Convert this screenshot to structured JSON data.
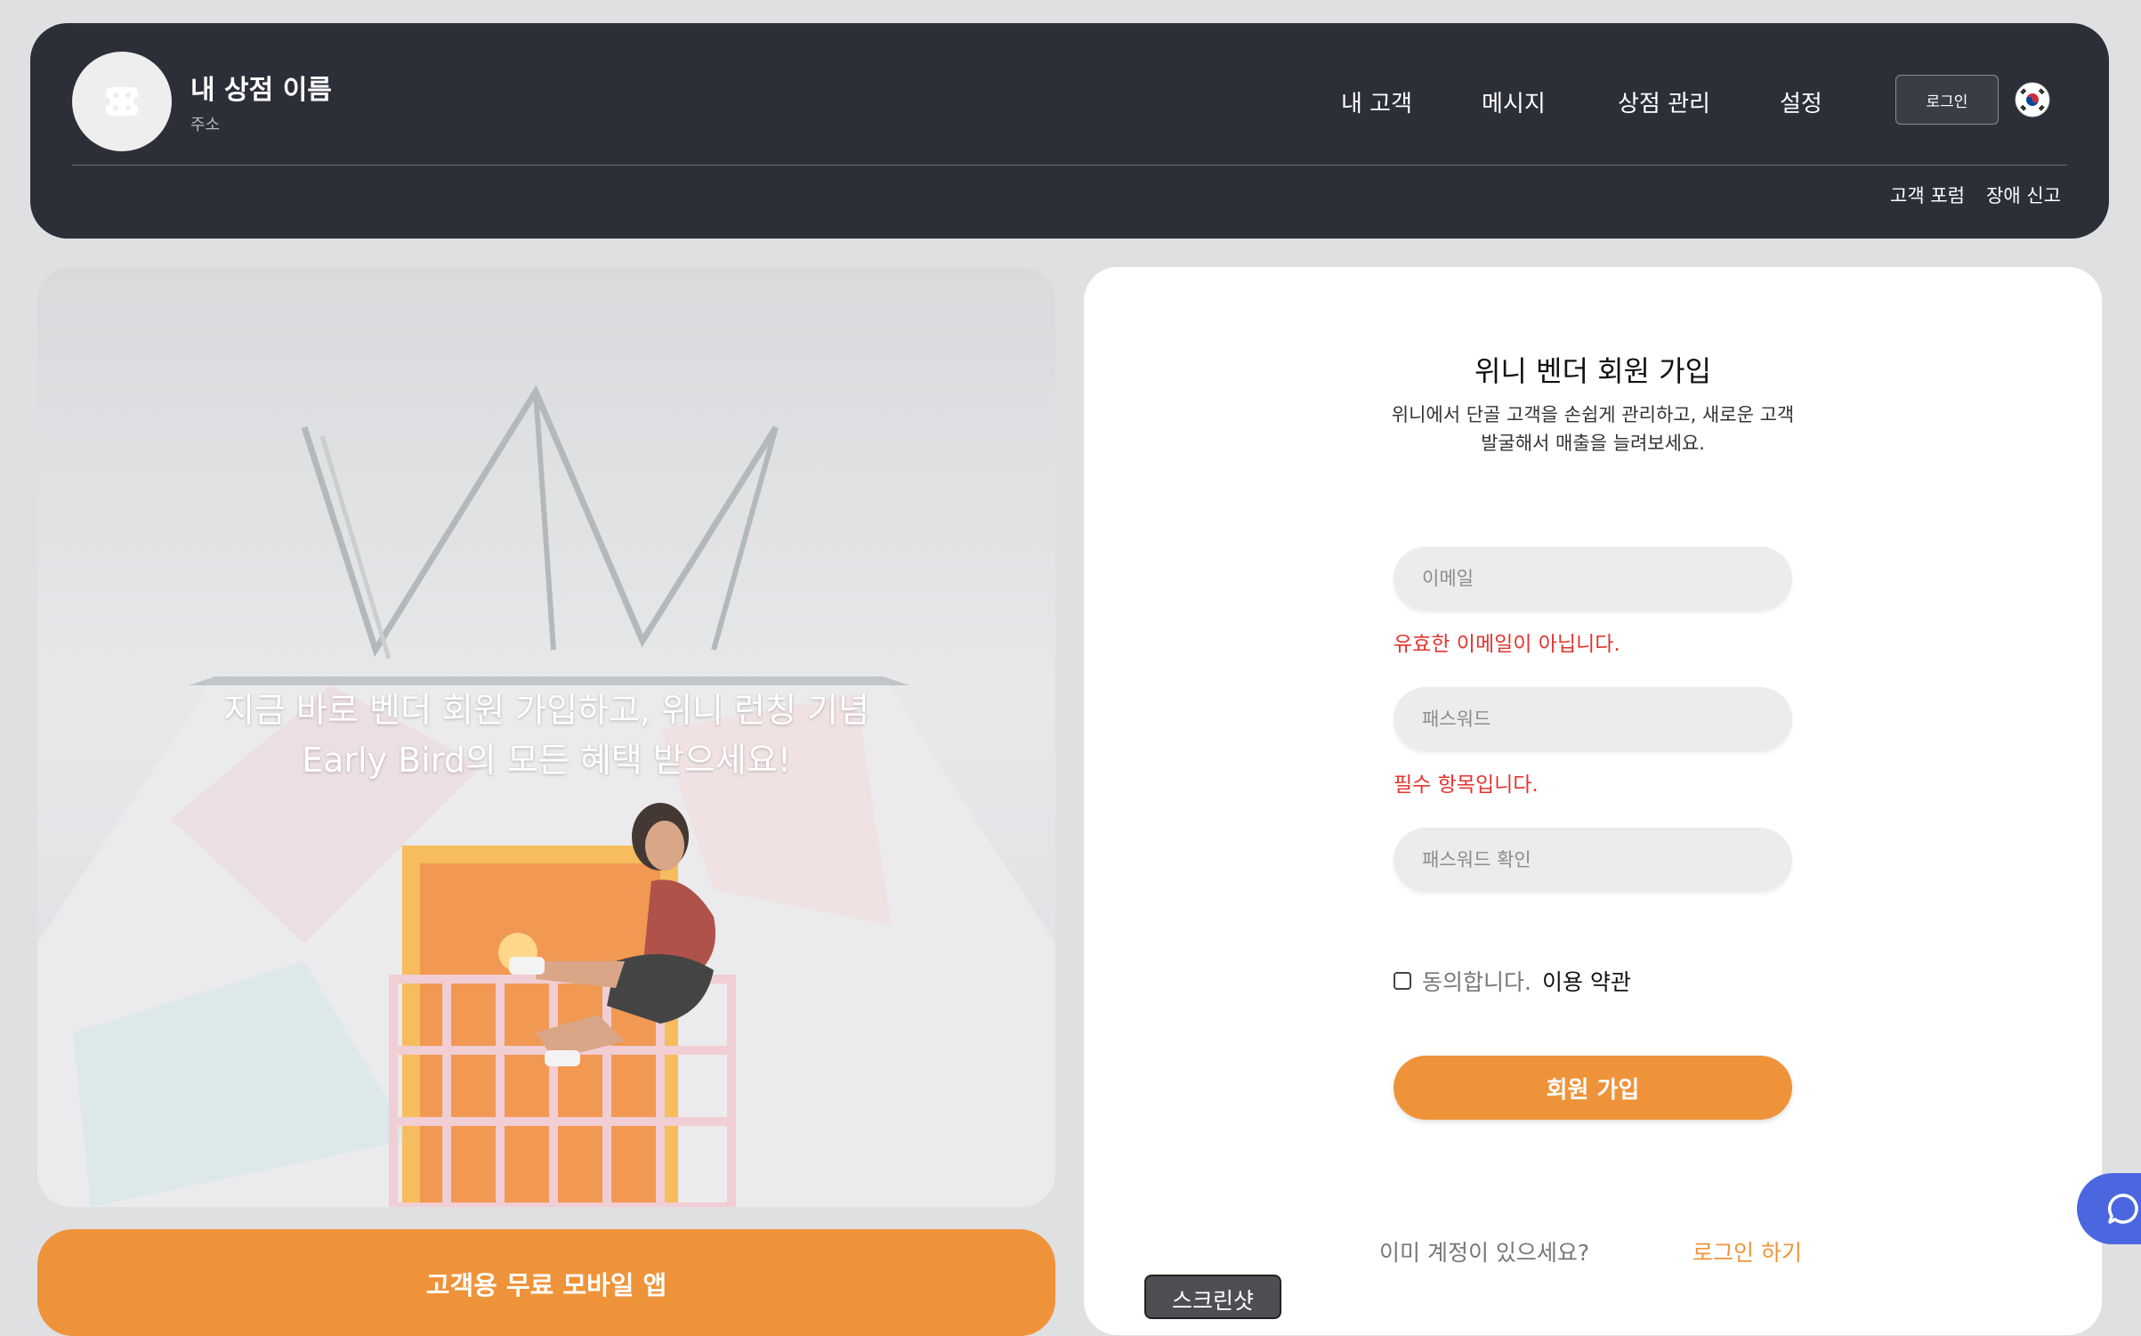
{
  "header": {
    "store_name": "내 상점 이름",
    "store_address": "주소",
    "nav": [
      "내 고객",
      "메시지",
      "상점 관리",
      "설정"
    ],
    "login_button": "로그인",
    "language_flag_icon": "korea-flag-icon",
    "sub_links": [
      "고객 포럼",
      "장애 신고"
    ]
  },
  "hero": {
    "line1": "지금 바로 벤더 회원 가입하고, 위니 런칭 기념",
    "line2": "Early Bird의 모든 혜택 받으세요!"
  },
  "app_banner": {
    "label": "고객용 무료 모바일 앱"
  },
  "signup": {
    "title": "위니 벤더 회원 가입",
    "desc_line1": "위니에서 단골 고객을 손쉽게 관리하고, 새로운 고객",
    "desc_line2": "발굴해서 매출을 늘려보세요.",
    "email_placeholder": "이메일",
    "email_error": "유효한 이메일이 아닙니다.",
    "password_placeholder": "패스워드",
    "password_error": "필수 항목입니다.",
    "password_confirm_placeholder": "패스워드 확인",
    "agree_text": "동의합니다.",
    "terms_link": "이용 약관",
    "submit": "회원 가입",
    "have_account": "이미 계정이 있으세요?",
    "login_link": "로그인 하기"
  },
  "floating": {
    "chat_icon": "chat-bubble-icon",
    "screenshot_tab": "스크린샷"
  },
  "colors": {
    "accent": "#ef933a",
    "header_bg": "#2c2f38",
    "error": "#e3342f",
    "chat": "#4a67e0"
  }
}
